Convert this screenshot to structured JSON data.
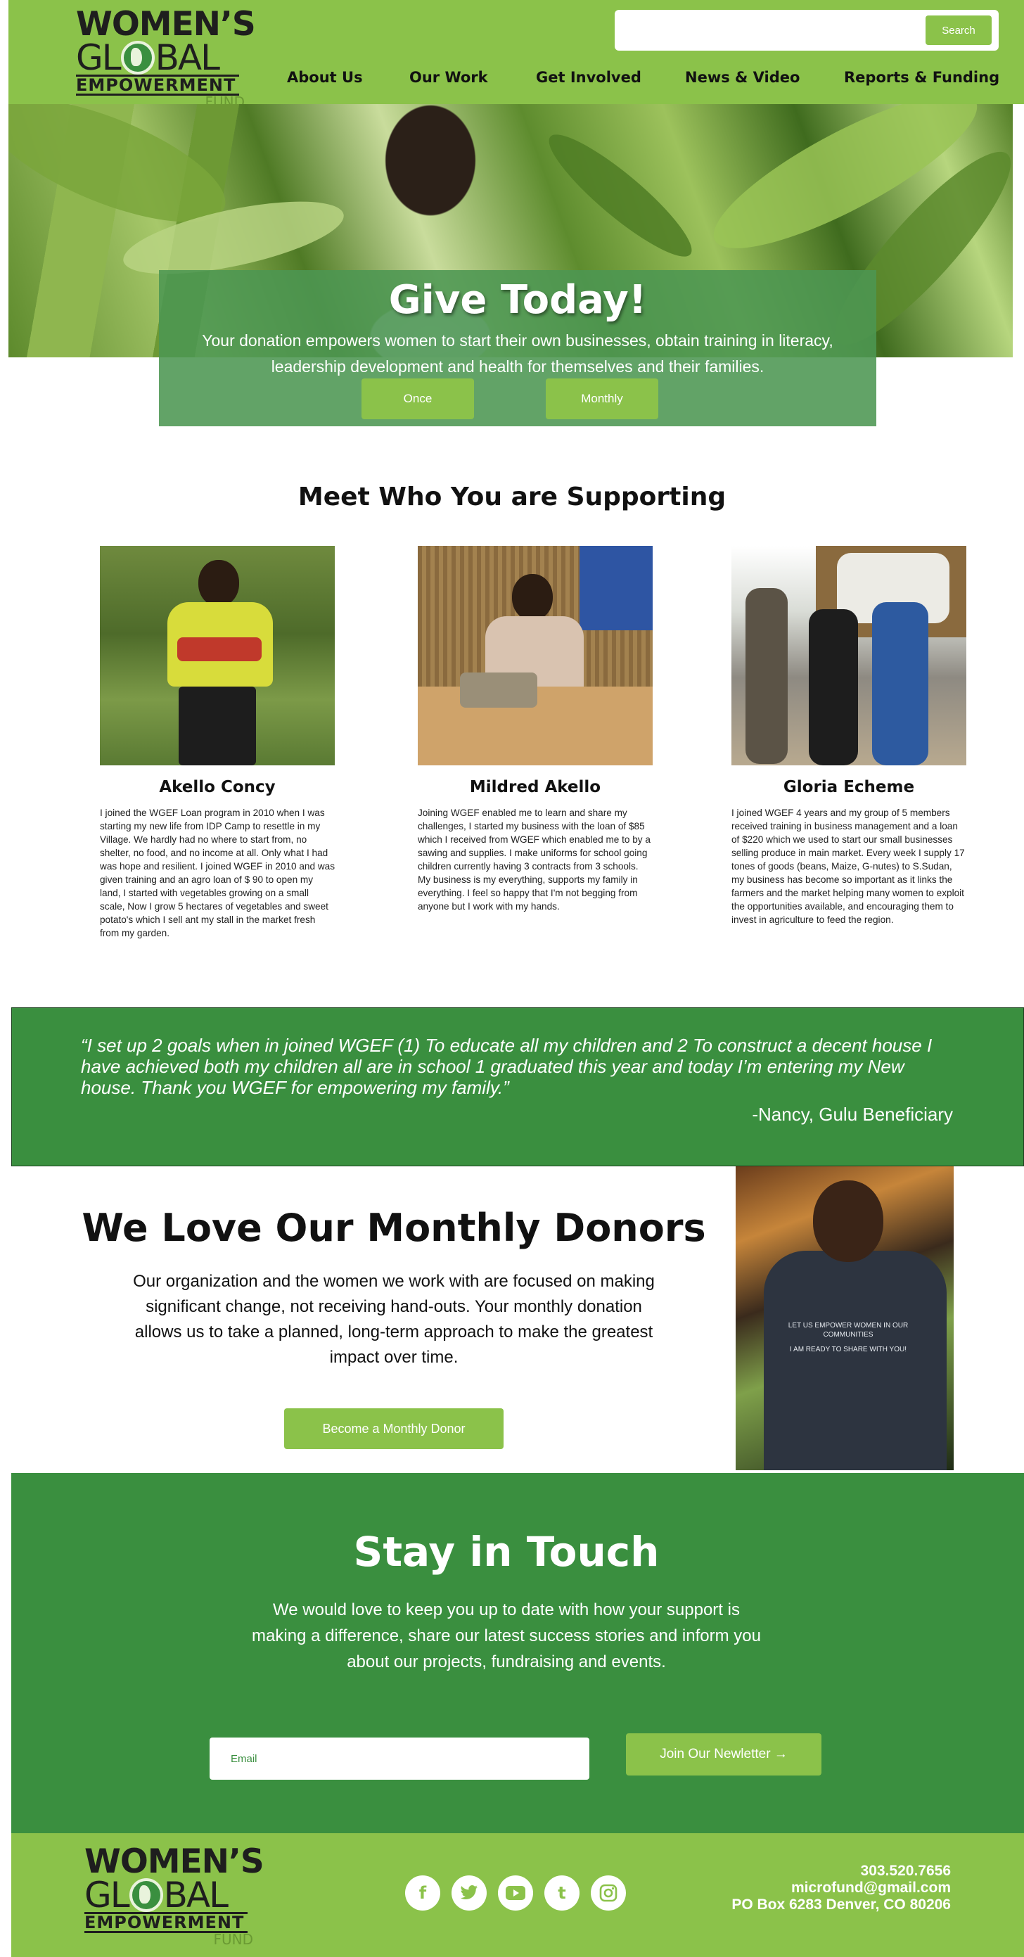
{
  "brand": {
    "logo_line1": "WOMEN’S",
    "logo_line2_a": "GL",
    "logo_line2_b": "BAL",
    "logo_line3": "EMPOWERMENT",
    "logo_line4": "FUND",
    "green": "#8bc24a",
    "dark_green": "#3a8f3f"
  },
  "header": {
    "search_button": "Search",
    "search_placeholder": "",
    "nav": [
      "About Us",
      "Our Work",
      "Get Involved",
      "News & Video",
      "Reports & Funding"
    ]
  },
  "hero": {
    "title": "Give Today!",
    "text": "Your donation empowers women to start their own businesses, obtain training in literacy, leadership development and health for themselves and their families.",
    "once_button": "Once",
    "monthly_button": "Monthly"
  },
  "meet": {
    "title": "Meet Who You are Supporting",
    "people": [
      {
        "name": "Akello Concy",
        "bio": "I joined the WGEF Loan program in 2010 when I was starting my new life from IDP Camp to resettle in my Village. We hardly had no where to start from, no shelter, no food, and no income at all. Only what I had was hope and resilient.  I joined WGEF in 2010 and was given training and an agro loan of $ 90 to open my land, I started with vegetables growing on a small scale, Now I grow 5 hectares of vegetables and sweet potato's which I sell ant my stall in the market fresh from my garden."
      },
      {
        "name": "Mildred Akello",
        "bio": "Joining WGEF enabled me to learn and share my challenges, I started my business with the loan of $85 which I received from WGEF which enabled me to by a sawing and supplies. I make uniforms for school going children currently having 3 contracts from 3 schools. My business is my everything, supports my family in everything. I feel so happy that I'm not begging from anyone but I work with my hands."
      },
      {
        "name": "Gloria Echeme",
        "bio": "I joined WGEF 4 years and my group of 5 members received training in business management and a loan of $220 which we used to start our small businesses selling produce in main market. Every week I supply 17 tones of goods (beans, Maize, G-nutes) to S.Sudan, my business has become so important as it links the farmers and the market helping many women to exploit the opportunities available, and encouraging them to invest in agriculture to feed the region."
      }
    ]
  },
  "quote": {
    "text": "“I set up 2 goals when in joined WGEF (1) To educate all my children and 2 To construct a decent house I have achieved both my children all are in school 1 graduated this year and today I’m entering my New house. Thank you WGEF for empowering my family.”",
    "attribution": "-Nancy, Gulu Beneficiary"
  },
  "donors": {
    "title": "We Love Our Monthly Donors",
    "text": "Our organization and the women we work with are focused on making significant change, not receiving hand-outs.  Your monthly donation allows us to take a planned, long-term approach to make the greatest impact over time.",
    "button": "Become a Monthly Donor",
    "shirt_text_1": "LET US EMPOWER WOMEN IN OUR COMMUNITIES",
    "shirt_text_2": "I AM READY TO SHARE WITH YOU!"
  },
  "stay": {
    "title": "Stay in Touch",
    "text": "We would love to keep you up to date with how your support is making a difference, share our latest success stories and inform you about our projects, fundraising and events.",
    "email_placeholder": "Email",
    "join_button": "Join Our Newletter →"
  },
  "footer": {
    "social_icons": [
      "facebook-icon",
      "twitter-icon",
      "youtube-icon",
      "tumblr-icon",
      "instagram-icon"
    ],
    "phone": "303.520.7656",
    "email": "microfund@gmail.com",
    "address": "PO Box 6283 Denver, CO 80206"
  }
}
